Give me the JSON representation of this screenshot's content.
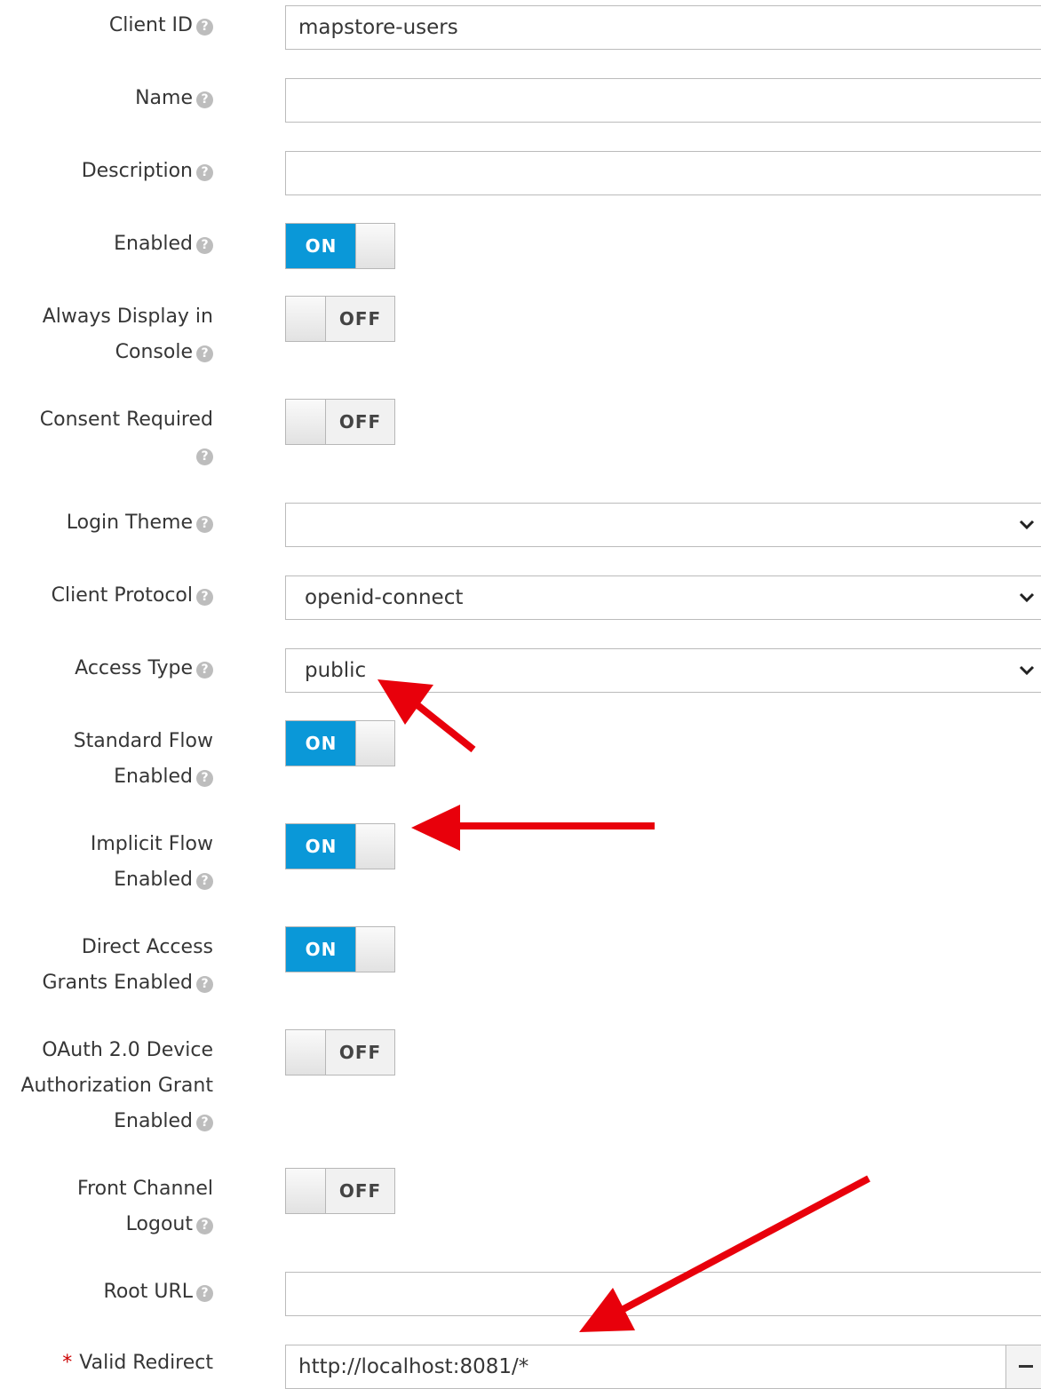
{
  "fields": {
    "client_id": {
      "label": "Client ID",
      "value": "mapstore-users"
    },
    "name": {
      "label": "Name",
      "value": ""
    },
    "description": {
      "label": "Description",
      "value": ""
    },
    "enabled": {
      "label": "Enabled",
      "state": "ON"
    },
    "always_display": {
      "label_line1": "Always Display in",
      "label_line2": "Console",
      "state": "OFF"
    },
    "consent_required": {
      "label": "Consent Required",
      "state": "OFF"
    },
    "login_theme": {
      "label": "Login Theme",
      "value": ""
    },
    "client_protocol": {
      "label": "Client Protocol",
      "value": "openid-connect"
    },
    "access_type": {
      "label": "Access Type",
      "value": "public"
    },
    "standard_flow": {
      "label_line1": "Standard Flow",
      "label_line2": "Enabled",
      "state": "ON"
    },
    "implicit_flow": {
      "label_line1": "Implicit Flow",
      "label_line2": "Enabled",
      "state": "ON"
    },
    "direct_access": {
      "label_line1": "Direct Access",
      "label_line2": "Grants Enabled",
      "state": "ON"
    },
    "oauth_device": {
      "label_line1": "OAuth 2.0 Device",
      "label_line2": "Authorization Grant",
      "label_line3": "Enabled",
      "state": "OFF"
    },
    "front_channel": {
      "label_line1": "Front Channel",
      "label_line2": "Logout",
      "state": "OFF"
    },
    "root_url": {
      "label": "Root URL",
      "value": ""
    },
    "valid_redirect": {
      "required_marker": "*",
      "label": "Valid Redirect",
      "value": "http://localhost:8081/*"
    }
  },
  "help_glyph": "?",
  "colors": {
    "toggle_on": "#0a98d8",
    "annotation_arrow": "#e8000b",
    "required": "#cc0000"
  },
  "icons": {
    "help": "question-circle-icon",
    "dropdown": "chevron-down-icon",
    "remove": "minus-icon"
  }
}
